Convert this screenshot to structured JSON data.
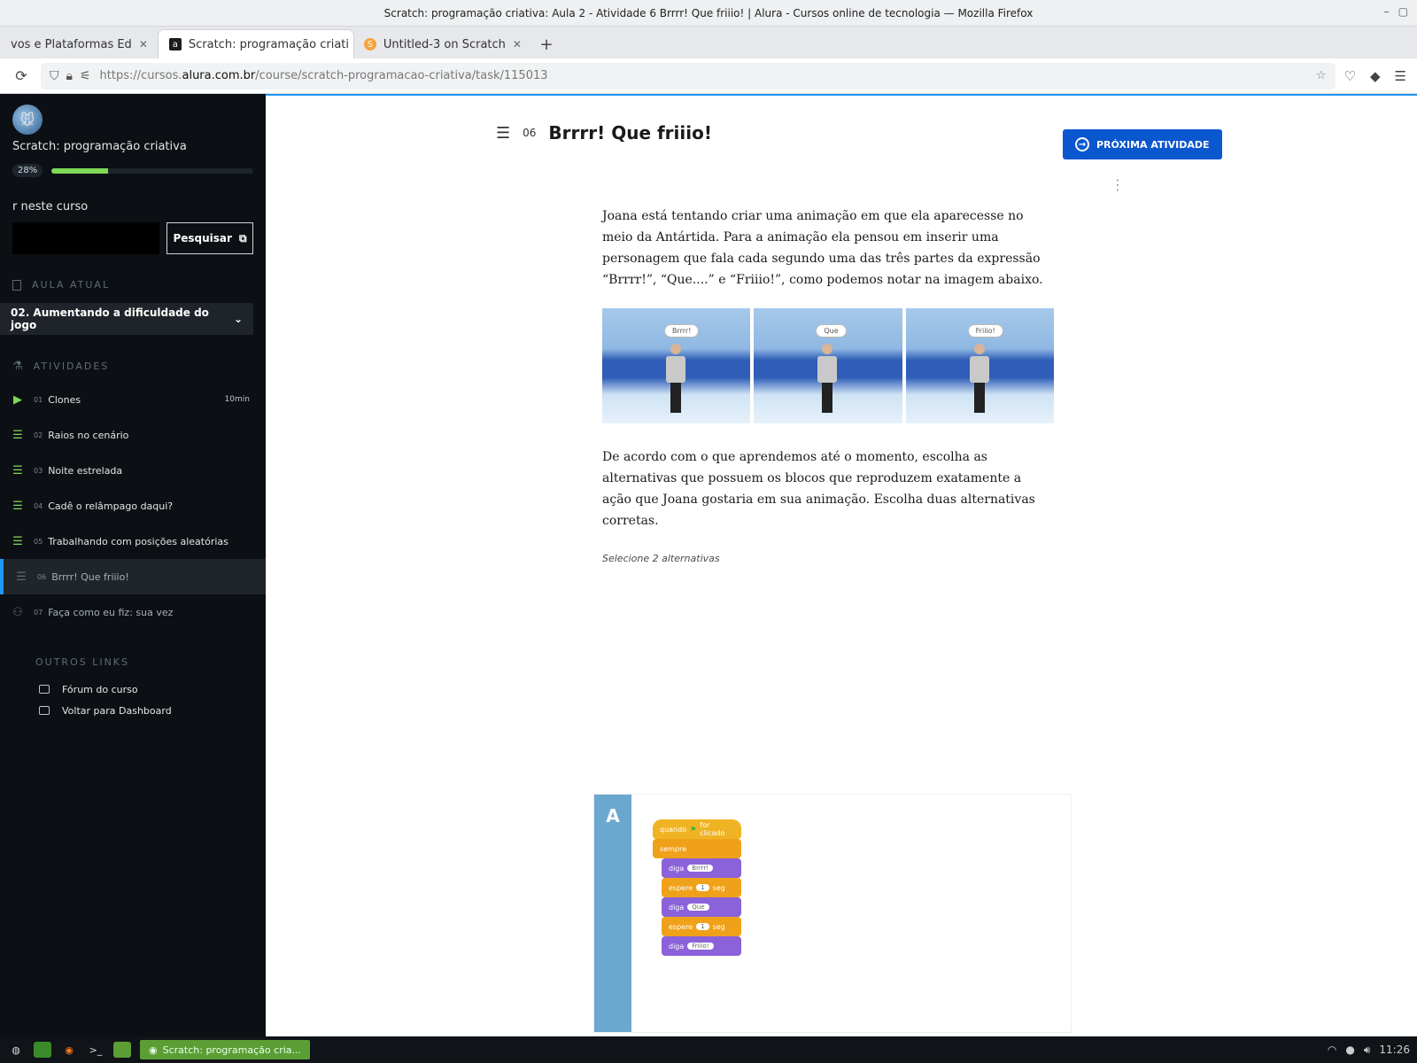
{
  "window": {
    "title": "Scratch: programação criativa: Aula 2 - Atividade 6 Brrrr! Que friiio! | Alura - Cursos online de tecnologia — Mozilla Firefox"
  },
  "tabs": [
    {
      "label": "vos e Plataformas Ed",
      "favicon": "",
      "active": false
    },
    {
      "label": "Scratch: programação criati",
      "favicon": "a",
      "active": true
    },
    {
      "label": "Untitled-3 on Scratch",
      "favicon": "S",
      "active": false
    }
  ],
  "urlbar": {
    "url_prefix": "https://cursos.",
    "url_host": "alura.com.br",
    "url_path": "/course/scratch-programacao-criativa/task/115013"
  },
  "sidebar": {
    "course_title": "Scratch: programação criativa",
    "progress_label": "28%",
    "progress_value": 0.28,
    "search_label": "r neste curso",
    "search_button": "Pesquisar",
    "current_lesson_heading": "AULA ATUAL",
    "current_lesson": "02. Aumentando a dificuldade do jogo",
    "activities_heading": "ATIVIDADES",
    "activities": [
      {
        "num": "01",
        "label": "Clones",
        "duration": "10min",
        "icon": "video-icon"
      },
      {
        "num": "02",
        "label": "Raios no cenário",
        "duration": "",
        "icon": "list-icon"
      },
      {
        "num": "03",
        "label": "Noite estrelada",
        "duration": "",
        "icon": "list-icon"
      },
      {
        "num": "04",
        "label": "Cadê o relâmpago daqui?",
        "duration": "",
        "icon": "list-icon"
      },
      {
        "num": "05",
        "label": "Trabalhando com posições aleatórias",
        "duration": "",
        "icon": "list-icon"
      },
      {
        "num": "06",
        "label": "Brrrr! Que friiio!",
        "duration": "",
        "icon": "list-icon"
      },
      {
        "num": "07",
        "label": "Faça como eu fiz: sua vez",
        "duration": "",
        "icon": "practice-icon"
      }
    ],
    "other_links_heading": "OUTROS LINKS",
    "links": [
      {
        "label": "Fórum do curso"
      },
      {
        "label": "Voltar para Dashboard"
      }
    ]
  },
  "task": {
    "number": "06",
    "title": "Brrrr! Que friiio!",
    "next_button": "PRÓXIMA ATIVIDADE",
    "paragraph1": "Joana está tentando criar uma animação em que ela aparecesse no meio da Antártida. Para a animação ela pensou em inserir uma personagem que fala cada segundo uma das três partes da expressão “Brrrr!”, “Que....” e “Friiio!”, como podemos notar na imagem abaixo.",
    "bubbles": [
      "Brrrr!",
      "Que",
      "Friiio!"
    ],
    "paragraph2": "De acordo com o que aprendemos até o momento, escolha as alternativas que possuem os blocos que reproduzem exatamente a ação que Joana gostaria em sua animação. Escolha duas alternativas corretas.",
    "hint": "Selecione 2 alternativas",
    "alternative": {
      "letter": "A",
      "blocks": {
        "when_flag_a": "quando",
        "when_flag_b": "for clicado",
        "forever": "sempre",
        "say1_label": "diga",
        "say1_value": "Brrrr!",
        "wait1_label": "espere",
        "wait1_value": "1",
        "wait1_unit": "seg",
        "say2_label": "diga",
        "say2_value": "Que",
        "wait2_label": "espere",
        "wait2_value": "1",
        "wait2_unit": "seg",
        "say3_label": "diga",
        "say3_value": "Friiio!"
      }
    }
  },
  "taskbar": {
    "active_window": "Scratch: programação cria...",
    "clock": "11:26"
  },
  "colors": {
    "accent": "#0b57d0",
    "progress": "#7ed957",
    "sidebar_bg": "#0c1014"
  }
}
